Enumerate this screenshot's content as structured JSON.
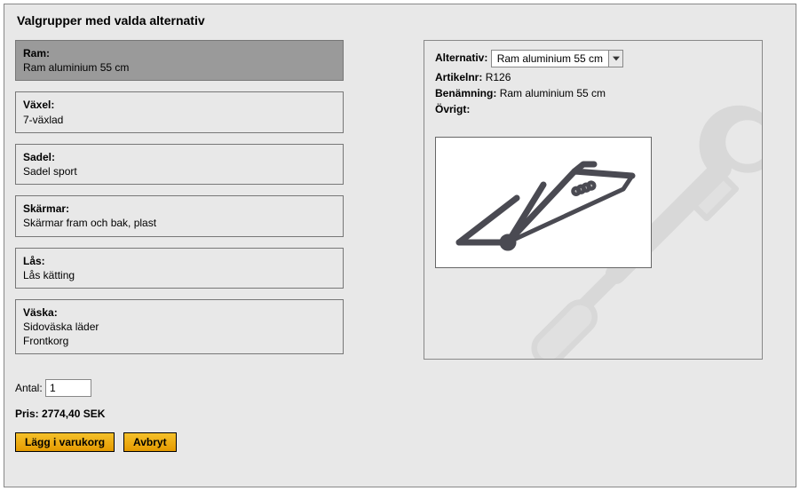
{
  "title": "Valgrupper med valda alternativ",
  "groups": [
    {
      "label": "Ram:",
      "values": [
        "Ram aluminium 55 cm"
      ],
      "selected": true
    },
    {
      "label": "Växel:",
      "values": [
        "7-växlad"
      ],
      "selected": false
    },
    {
      "label": "Sadel:",
      "values": [
        "Sadel sport"
      ],
      "selected": false
    },
    {
      "label": "Skärmar:",
      "values": [
        "Skärmar fram och bak, plast"
      ],
      "selected": false
    },
    {
      "label": "Lås:",
      "values": [
        "Lås kätting"
      ],
      "selected": false
    },
    {
      "label": "Väska:",
      "values": [
        "Sidoväska läder",
        "Frontkorg"
      ],
      "selected": false
    }
  ],
  "detail": {
    "alt_label": "Alternativ:",
    "alt_selected": "Ram aluminium 55 cm",
    "article_label": "Artikelnr:",
    "article_value": "R126",
    "name_label": "Benämning:",
    "name_value": "Ram aluminium 55 cm",
    "other_label": "Övrigt:"
  },
  "qty_label": "Antal:",
  "qty_value": "1",
  "price_label": "Pris:",
  "price_value": "2774,40 SEK",
  "buttons": {
    "add": "Lägg i varukorg",
    "cancel": "Avbryt"
  }
}
